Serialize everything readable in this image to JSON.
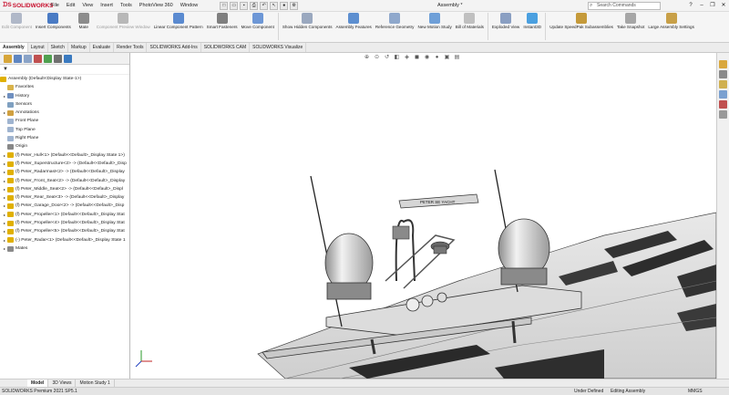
{
  "app": {
    "logo": "SOLIDWORKS",
    "menu": [
      "File",
      "Edit",
      "View",
      "Insert",
      "Tools",
      "PhotoView 360",
      "Window"
    ],
    "doc_title": "Assembly *",
    "search_placeholder": "Search Commands"
  },
  "ribbon": [
    {
      "label": "Edit Component",
      "dim": true,
      "color": "#b0b8c8"
    },
    {
      "label": "Insert Components",
      "color": "#4a7bc4"
    },
    {
      "label": "Mate",
      "color": "#8c8c8c"
    },
    {
      "label": "Component Preview Window",
      "dim": true,
      "color": "#b8b8b8"
    },
    {
      "label": "Linear Component Pattern",
      "color": "#5a8ad0"
    },
    {
      "label": "Smart Fasteners",
      "color": "#7f7f7f"
    },
    {
      "label": "Move Component",
      "color": "#6d97d6"
    },
    {
      "label": "Show Hidden Components",
      "color": "#9aa8bf"
    },
    {
      "label": "Assembly Features",
      "color": "#5d8fd0"
    },
    {
      "label": "Reference Geometry",
      "color": "#8fa8cc"
    },
    {
      "label": "New Motion Study",
      "color": "#6e9fd8"
    },
    {
      "label": "Bill of Materials",
      "color": "#c0c0c0"
    },
    {
      "label": "Exploded View",
      "color": "#8a9fc2"
    },
    {
      "label": "Instant3D",
      "color": "#4aa0e0"
    },
    {
      "label": "Update SpeedPak Subassemblies",
      "color": "#c59a3a"
    },
    {
      "label": "Take Snapshot",
      "color": "#a6a6a6"
    },
    {
      "label": "Large Assembly Settings",
      "color": "#c8a048"
    }
  ],
  "tabs": [
    "Assembly",
    "Layout",
    "Sketch",
    "Markup",
    "Evaluate",
    "Render Tools",
    "SOLIDWORKS Add-Ins",
    "SOLIDWORKS CAM",
    "SOLIDWORKS Visualize"
  ],
  "tree": {
    "root": "Assembly (Default<Display State-1>)",
    "items": [
      {
        "label": "Favorites",
        "arrow": false,
        "color": "#d9b34a"
      },
      {
        "label": "History",
        "arrow": true,
        "color": "#6f8fbf"
      },
      {
        "label": "Sensors",
        "arrow": false,
        "color": "#7fa0c0"
      },
      {
        "label": "Annotations",
        "arrow": true,
        "color": "#d0a040"
      },
      {
        "label": "Front Plane",
        "arrow": false,
        "color": "#9fb4d0"
      },
      {
        "label": "Top Plane",
        "arrow": false,
        "color": "#9fb4d0"
      },
      {
        "label": "Right Plane",
        "arrow": false,
        "color": "#9fb4d0"
      },
      {
        "label": "Origin",
        "arrow": false,
        "color": "#888"
      },
      {
        "label": "(f) Peter_Hull<1> (Default<<Default>_Display State 1>)",
        "arrow": true,
        "color": "#e0b000"
      },
      {
        "label": "(f) Peter_Superstructure<2> -> (Default<<Default>_Disp",
        "arrow": true,
        "color": "#e0b000"
      },
      {
        "label": "(f) Peter_Radarmast<2> -> (Default<<Default>_Display",
        "arrow": true,
        "color": "#e0b000"
      },
      {
        "label": "(f) Peter_Front_Seat<2> -> (Default<<Default>_Display",
        "arrow": true,
        "color": "#e0b000"
      },
      {
        "label": "(f) Peter_Middle_Seat<2> -> (Default<<Default>_Displ",
        "arrow": true,
        "color": "#e0b000"
      },
      {
        "label": "(f) Peter_Rear_Seat<3> -> (Default<<Default>_Display",
        "arrow": true,
        "color": "#e0b000"
      },
      {
        "label": "(f) Peter_Garage_Door<2> -> (Default<<Default>_Disp",
        "arrow": true,
        "color": "#e0b000"
      },
      {
        "label": "(f) Peter_Propeller<1> (Default<<Default>_Display Stat",
        "arrow": true,
        "color": "#e0b000"
      },
      {
        "label": "(f) Peter_Propeller<4> (Default<<Default>_Display Stat",
        "arrow": true,
        "color": "#e0b000"
      },
      {
        "label": "(f) Peter_Propeller<5> (Default<<Default>_Display Stat",
        "arrow": true,
        "color": "#e0b000"
      },
      {
        "label": "(-) Peter_Radar<1> (Default<<Default>_Display State 1",
        "arrow": true,
        "color": "#e0b000"
      },
      {
        "label": "Mates",
        "arrow": true,
        "color": "#8a8a8a"
      }
    ]
  },
  "model": {
    "nameplate": "PETER SE YACHT"
  },
  "bottom_tabs": [
    "Model",
    "3D Views",
    "Motion Study 1"
  ],
  "status": {
    "left": "SOLIDWORKS Premium 2021 SP5.1",
    "s1": "Under Defined",
    "s2": "Editing Assembly",
    "s3": "MMGS"
  }
}
